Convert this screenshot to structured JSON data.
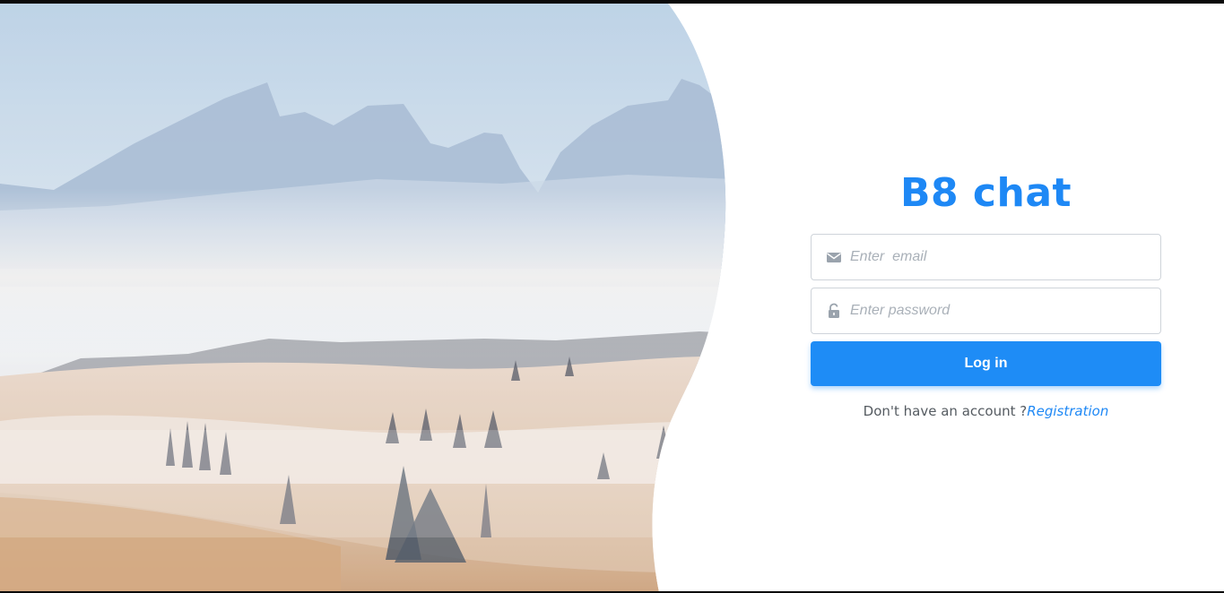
{
  "app": {
    "brand_title": "B8 chat",
    "accent_color": "#1e88f5"
  },
  "login_form": {
    "email": {
      "placeholder": "Enter  email",
      "value": "",
      "icon": "envelope-icon"
    },
    "password": {
      "placeholder": "Enter password",
      "value": "",
      "icon": "lock-icon"
    },
    "submit_label": "Log in",
    "register_prompt": "Don't have an account ?",
    "register_link": "Registration"
  },
  "hero": {
    "description_icon": "landscape-image"
  }
}
